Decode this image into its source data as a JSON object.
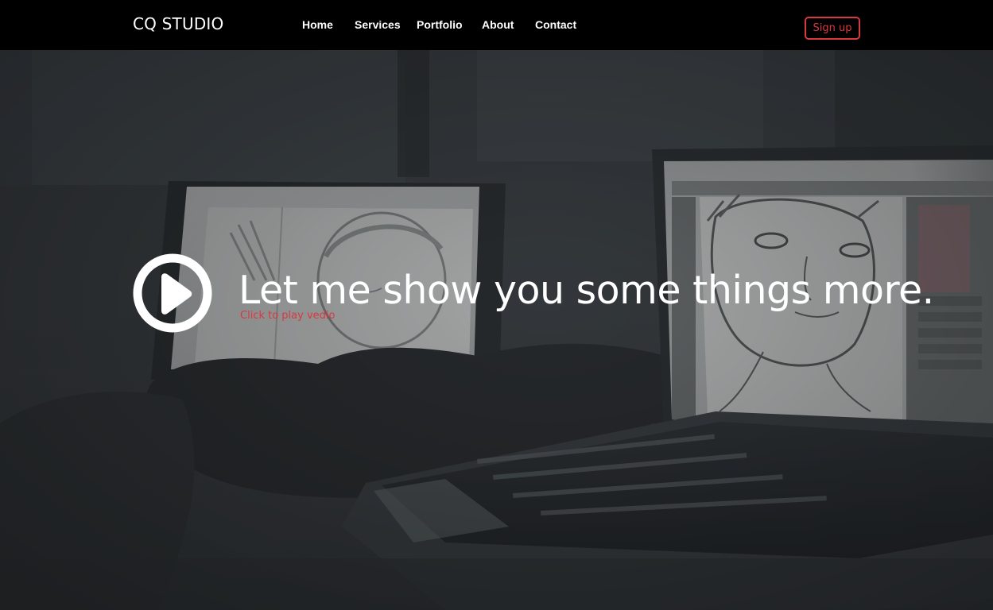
{
  "brand": {
    "name": "CQ STUDIO"
  },
  "nav": {
    "items": [
      {
        "label": "Home"
      },
      {
        "label": "Services"
      },
      {
        "label": "Portfolio"
      },
      {
        "label": "About"
      },
      {
        "label": "Contact"
      }
    ],
    "signup_label": "Sign up"
  },
  "hero": {
    "title": "Let me show you some things more.",
    "subtitle": "Click to play vedio",
    "play_icon": "play-circle-icon",
    "background": "photo of hands drawing a sketched portrait on a tablet and laptop"
  },
  "colors": {
    "nav_background": "#000000",
    "accent": "#d9383f",
    "text": "#ffffff",
    "hero_tint": "#3a3e41"
  }
}
